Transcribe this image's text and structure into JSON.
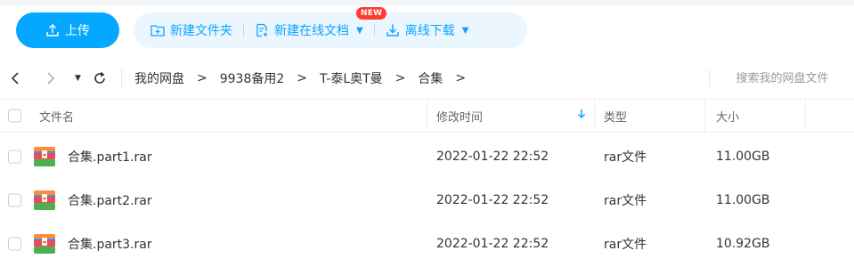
{
  "toolbar": {
    "upload_label": "上传",
    "new_folder_label": "新建文件夹",
    "new_online_doc_label": "新建在线文档",
    "new_badge": "NEW",
    "offline_download_label": "离线下载"
  },
  "nav": {
    "breadcrumbs": [
      "我的网盘",
      "9938备用2",
      "T-泰L奥T曼",
      "合集"
    ],
    "search_placeholder": "搜索我的网盘文件"
  },
  "table": {
    "headers": {
      "name": "文件名",
      "modified": "修改时间",
      "type": "类型",
      "size": "大小"
    },
    "rows": [
      {
        "name": "合集.part1.rar",
        "modified": "2022-01-22 22:52",
        "type": "rar文件",
        "size": "11.00GB"
      },
      {
        "name": "合集.part2.rar",
        "modified": "2022-01-22 22:52",
        "type": "rar文件",
        "size": "11.00GB"
      },
      {
        "name": "合集.part3.rar",
        "modified": "2022-01-22 22:52",
        "type": "rar文件",
        "size": "10.92GB"
      }
    ]
  },
  "colors": {
    "accent": "#06a7ff",
    "accent_light_bg": "#ecf6ff",
    "badge_red": "#ff3b30"
  },
  "icons": [
    "upload-icon",
    "new-folder-icon",
    "new-doc-icon",
    "download-icon",
    "back-icon",
    "forward-icon",
    "dropdown-icon",
    "refresh-icon",
    "sort-desc-icon",
    "rar-file-icon"
  ]
}
